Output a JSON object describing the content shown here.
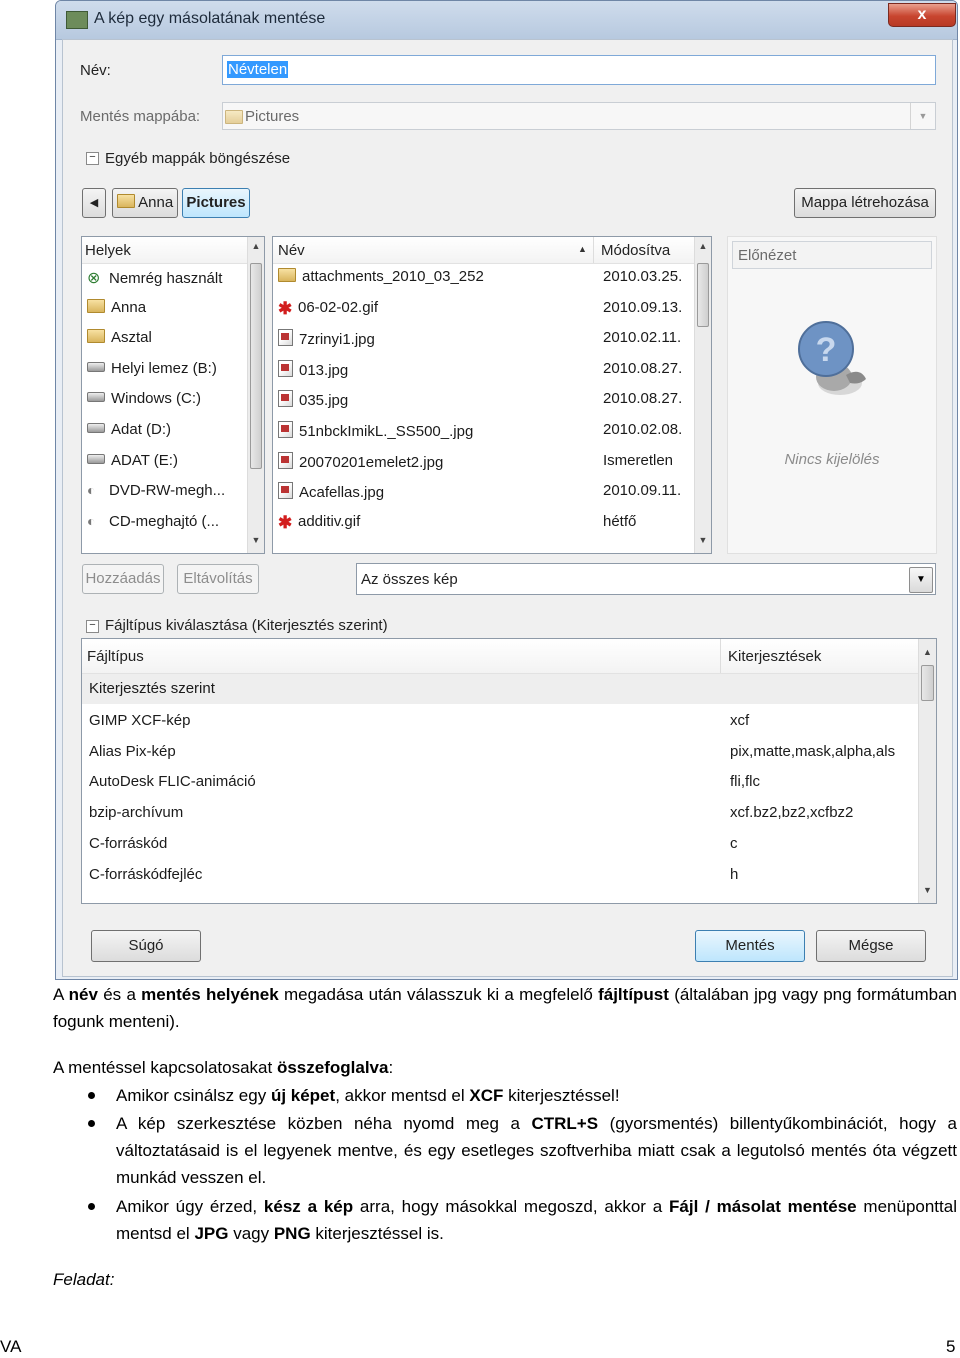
{
  "dialog": {
    "title": "A kép egy másolatának mentése",
    "close_symbol": "x",
    "name_label": "Név:",
    "name_value": "Névtelen",
    "save_in_label": "Mentés mappába:",
    "save_in_value": "Pictures",
    "browse_toggle": "Egyéb mappák böngészése",
    "path_buttons": [
      "Anna",
      "Pictures"
    ],
    "create_folder_button": "Mappa létrehozása",
    "places": {
      "header": "Helyek",
      "items": [
        {
          "label": "Nemrég használt",
          "icon": "recent-icon"
        },
        {
          "label": "Anna",
          "icon": "folder-icon"
        },
        {
          "label": "Asztal",
          "icon": "folder-icon"
        },
        {
          "label": "Helyi lemez (B:)",
          "icon": "drive-icon"
        },
        {
          "label": "Windows (C:)",
          "icon": "drive-icon"
        },
        {
          "label": "Adat (D:)",
          "icon": "drive-icon"
        },
        {
          "label": "ADAT (E:)",
          "icon": "drive-icon"
        },
        {
          "label": "DVD-RW-megh...",
          "icon": "optical-drive-icon"
        },
        {
          "label": "CD-meghajtó (...",
          "icon": "optical-drive-icon"
        }
      ],
      "add_button": "Hozzáadás",
      "remove_button": "Eltávolítás"
    },
    "files": {
      "name_header": "Név",
      "modified_header": "Módosítva",
      "rows": [
        {
          "name": "attachments_2010_03_252",
          "modified": "2010.03.25.",
          "icon": "folder-icon"
        },
        {
          "name": "06-02-02.gif",
          "modified": "2010.09.13.",
          "icon": "gif-icon"
        },
        {
          "name": "7zrinyi1.jpg",
          "modified": "2010.02.11.",
          "icon": "image-icon"
        },
        {
          "name": "013.jpg",
          "modified": "2010.08.27.",
          "icon": "image-icon"
        },
        {
          "name": "035.jpg",
          "modified": "2010.08.27.",
          "icon": "image-icon"
        },
        {
          "name": "51nbckImikL._SS500_.jpg",
          "modified": "2010.02.08.",
          "icon": "image-icon"
        },
        {
          "name": "20070201emelet2.jpg",
          "modified": "Ismeretlen",
          "icon": "image-icon"
        },
        {
          "name": "Acafellas.jpg",
          "modified": "2010.09.11.",
          "icon": "image-icon"
        },
        {
          "name": "additiv.gif",
          "modified": "hétfő",
          "icon": "gif-icon"
        }
      ]
    },
    "preview": {
      "label": "Előnézet",
      "empty_text": "Nincs kijelölés"
    },
    "filter_value": "Az összes kép",
    "filetype_toggle": "Fájltípus kiválasztása (Kiterjesztés szerint)",
    "filetypes": {
      "type_header": "Fájltípus",
      "ext_header": "Kiterjesztések",
      "rows": [
        {
          "type": "Kiterjesztés szerint",
          "ext": ""
        },
        {
          "type": "GIMP XCF-kép",
          "ext": "xcf"
        },
        {
          "type": "Alias Pix-kép",
          "ext": "pix,matte,mask,alpha,als"
        },
        {
          "type": "AutoDesk FLIC-animáció",
          "ext": "fli,flc"
        },
        {
          "type": "bzip-archívum",
          "ext": "xcf.bz2,bz2,xcfbz2"
        },
        {
          "type": "C-forráskód",
          "ext": "c"
        },
        {
          "type": "C-forráskódfejléc",
          "ext": "h"
        }
      ]
    },
    "help_button": "Súgó",
    "save_button": "Mentés",
    "cancel_button": "Mégse"
  },
  "document": {
    "intro_parts": [
      {
        "text": "A ",
        "bold": false
      },
      {
        "text": "név",
        "bold": true
      },
      {
        "text": " és a ",
        "bold": false
      },
      {
        "text": "mentés helyének",
        "bold": true
      },
      {
        "text": " megadása után válasszuk ki a megfelelő ",
        "bold": false
      },
      {
        "text": "fájltípust",
        "bold": true
      },
      {
        "text": " (általában jpg vagy png formátumban fogunk menteni).",
        "bold": false
      }
    ],
    "summary_parts": [
      {
        "text": "A mentéssel kapcsolatosakat ",
        "bold": false
      },
      {
        "text": "összefoglalva",
        "bold": true
      },
      {
        "text": ":",
        "bold": false
      }
    ],
    "bullets": [
      [
        {
          "text": "Amikor csinálsz egy ",
          "bold": false
        },
        {
          "text": "új képet",
          "bold": true
        },
        {
          "text": ", akkor mentsd el ",
          "bold": false
        },
        {
          "text": "XCF",
          "bold": true
        },
        {
          "text": " kiterjesztéssel!",
          "bold": false
        }
      ],
      [
        {
          "text": "A kép szerkesztése közben néha nyomd meg a ",
          "bold": false
        },
        {
          "text": "CTRL+S",
          "bold": true
        },
        {
          "text": " (gyorsmentés) billentyűkombinációt, hogy a változtatásaid is el legyenek mentve, és egy esetleges szoftverhiba miatt csak a legutolsó mentés óta végzett munkád vesszen el.",
          "bold": false
        }
      ],
      [
        {
          "text": "Amikor úgy érzed, ",
          "bold": false
        },
        {
          "text": "kész a kép",
          "bold": true
        },
        {
          "text": " arra, hogy másokkal megoszd, akkor a ",
          "bold": false
        },
        {
          "text": "Fájl / másolat mentése",
          "bold": true
        },
        {
          "text": " menüponttal mentsd el ",
          "bold": false
        },
        {
          "text": "JPG",
          "bold": true
        },
        {
          "text": " vagy ",
          "bold": false
        },
        {
          "text": "PNG",
          "bold": true
        },
        {
          "text": " kiterjesztéssel is.",
          "bold": false
        }
      ]
    ],
    "task_label": "Feladat:",
    "footer_left": "VA",
    "footer_page": "5"
  }
}
